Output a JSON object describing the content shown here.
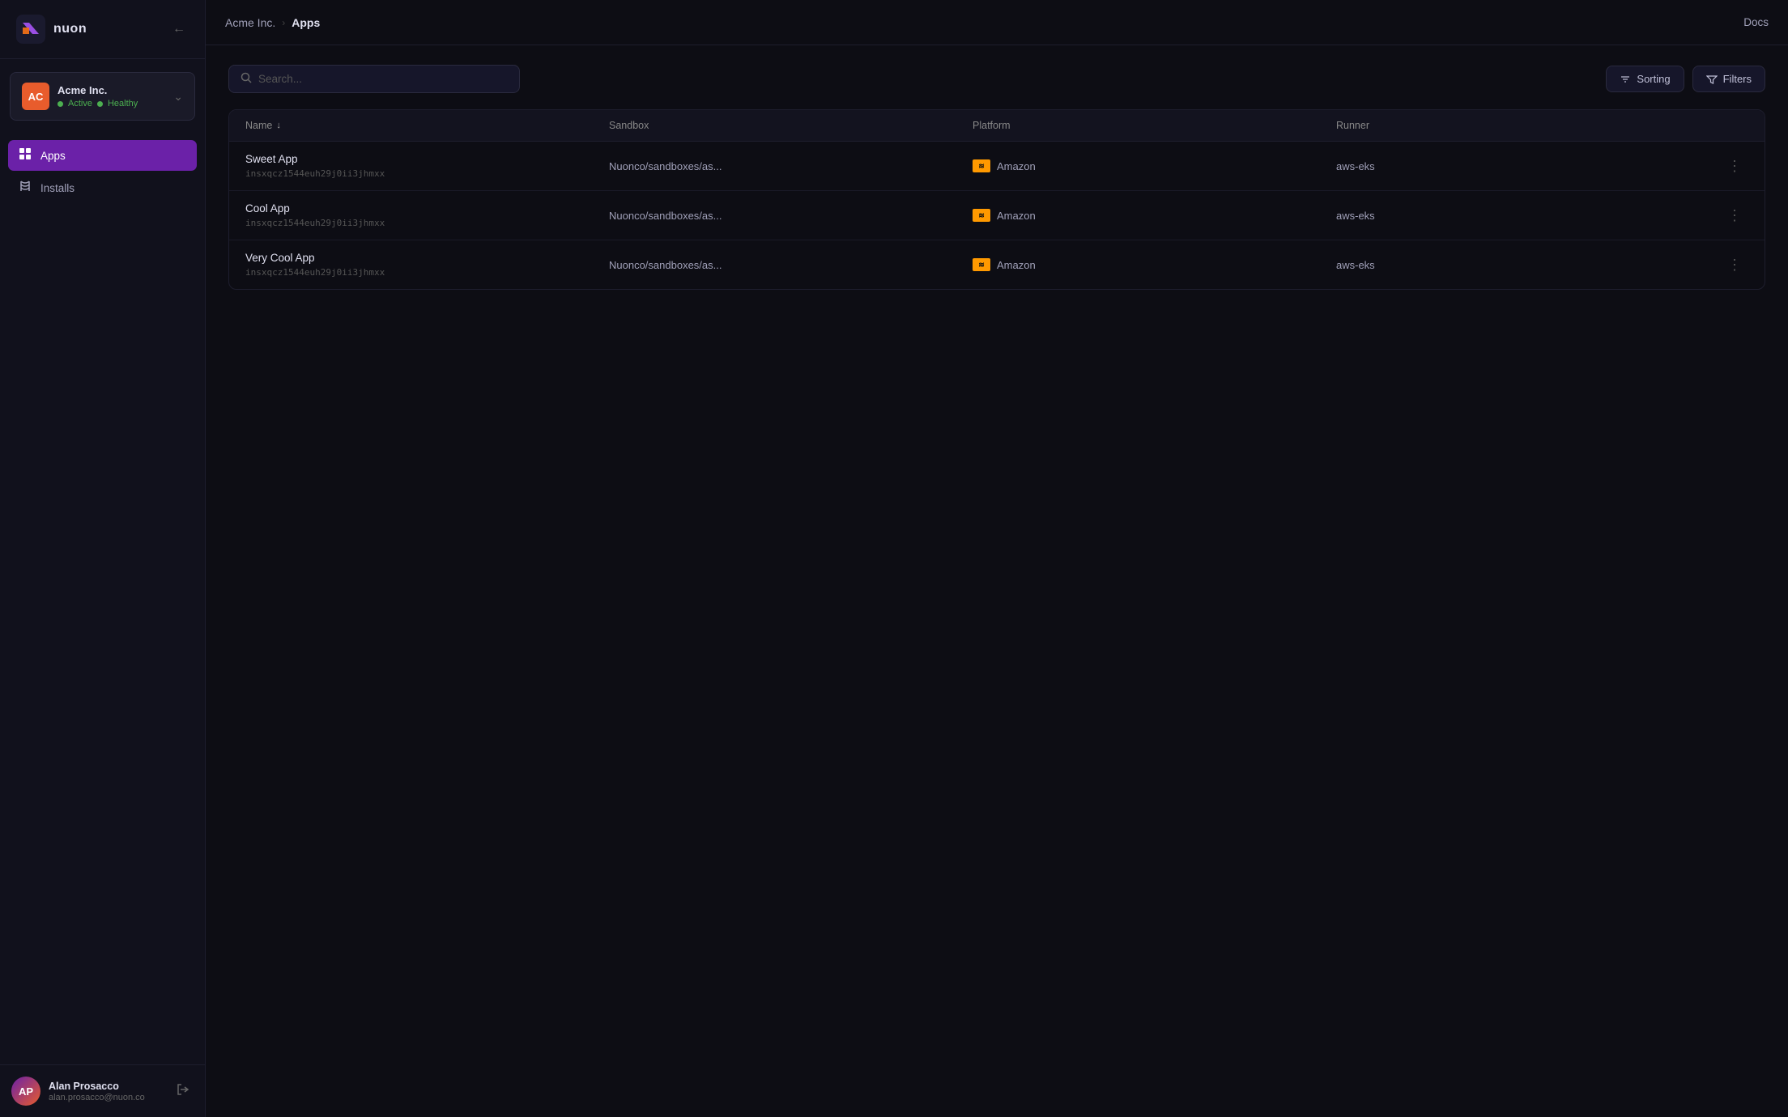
{
  "sidebar": {
    "logo_text": "nuon",
    "collapse_icon": "←",
    "workspace": {
      "avatar_text": "AC",
      "name": "Acme Inc.",
      "status_active": "Active",
      "status_healthy": "Healthy",
      "chevron": "⌃"
    },
    "nav_items": [
      {
        "id": "apps",
        "label": "Apps",
        "icon": "▦",
        "active": true
      },
      {
        "id": "installs",
        "label": "Installs",
        "icon": "🔧",
        "active": false
      }
    ],
    "user": {
      "name": "Alan Prosacco",
      "email": "alan.prosacco@nuon.co",
      "initials": "AP"
    },
    "logout_icon": "→"
  },
  "topbar": {
    "breadcrumb_parent": "Acme Inc.",
    "breadcrumb_separator": "›",
    "breadcrumb_current": "Apps",
    "docs_label": "Docs"
  },
  "content": {
    "search_placeholder": "Search...",
    "sorting_label": "Sorting",
    "filters_label": "Filters",
    "table": {
      "columns": [
        "Name",
        "Sandbox",
        "Platform",
        "Runner"
      ],
      "rows": [
        {
          "name": "Sweet App",
          "id": "insxqcz1544euh29j0ii3jhmxx",
          "sandbox": "Nuonco/sandboxes/as...",
          "platform": "Amazon",
          "runner": "aws-eks"
        },
        {
          "name": "Cool App",
          "id": "insxqcz1544euh29j0ii3jhmxx",
          "sandbox": "Nuonco/sandboxes/as...",
          "platform": "Amazon",
          "runner": "aws-eks"
        },
        {
          "name": "Very Cool App",
          "id": "insxqcz1544euh29j0ii3jhmxx",
          "sandbox": "Nuonco/sandboxes/as...",
          "platform": "Amazon",
          "runner": "aws-eks"
        }
      ]
    }
  }
}
